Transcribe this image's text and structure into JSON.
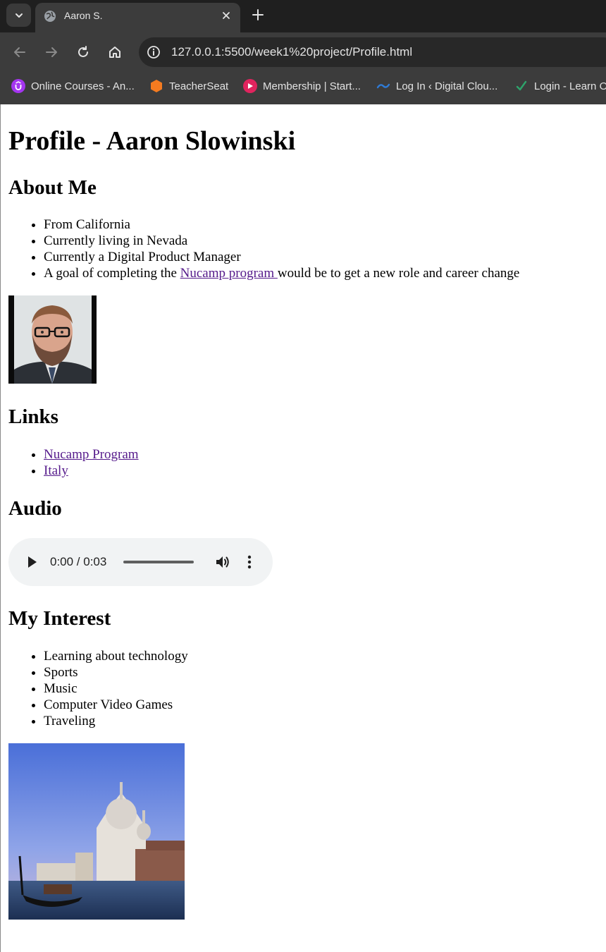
{
  "browser": {
    "tab_title": "Aaron S.",
    "url": "127.0.0.1:5500/week1%20project/Profile.html",
    "bookmarks": [
      {
        "label": "Online Courses - An...",
        "icon": "udemy-icon"
      },
      {
        "label": "TeacherSeat",
        "icon": "teacherseat-icon"
      },
      {
        "label": "Membership | Start...",
        "icon": "membership-icon"
      },
      {
        "label": "Log In ‹ Digital Clou...",
        "icon": "digital-cloud-icon"
      },
      {
        "label": "Login - Learn O",
        "icon": "checkmark-icon"
      }
    ]
  },
  "page": {
    "title": "Profile - Aaron Slowinski",
    "about": {
      "heading": "About Me",
      "items": [
        "From California",
        "Currently living in Nevada",
        "Currently a Digital Product Manager"
      ],
      "goal_prefix": "A goal of completing the ",
      "goal_link": "Nucamp program ",
      "goal_suffix": "would be to get a new role and career change"
    },
    "links": {
      "heading": "Links",
      "items": [
        "Nucamp Program",
        "Italy"
      ]
    },
    "audio": {
      "heading": "Audio",
      "time": "0:00 / 0:03",
      "progress": 0
    },
    "interests": {
      "heading": "My Interest",
      "items": [
        "Learning about technology",
        "Sports",
        "Music",
        "Computer Video Games",
        "Traveling"
      ]
    }
  }
}
